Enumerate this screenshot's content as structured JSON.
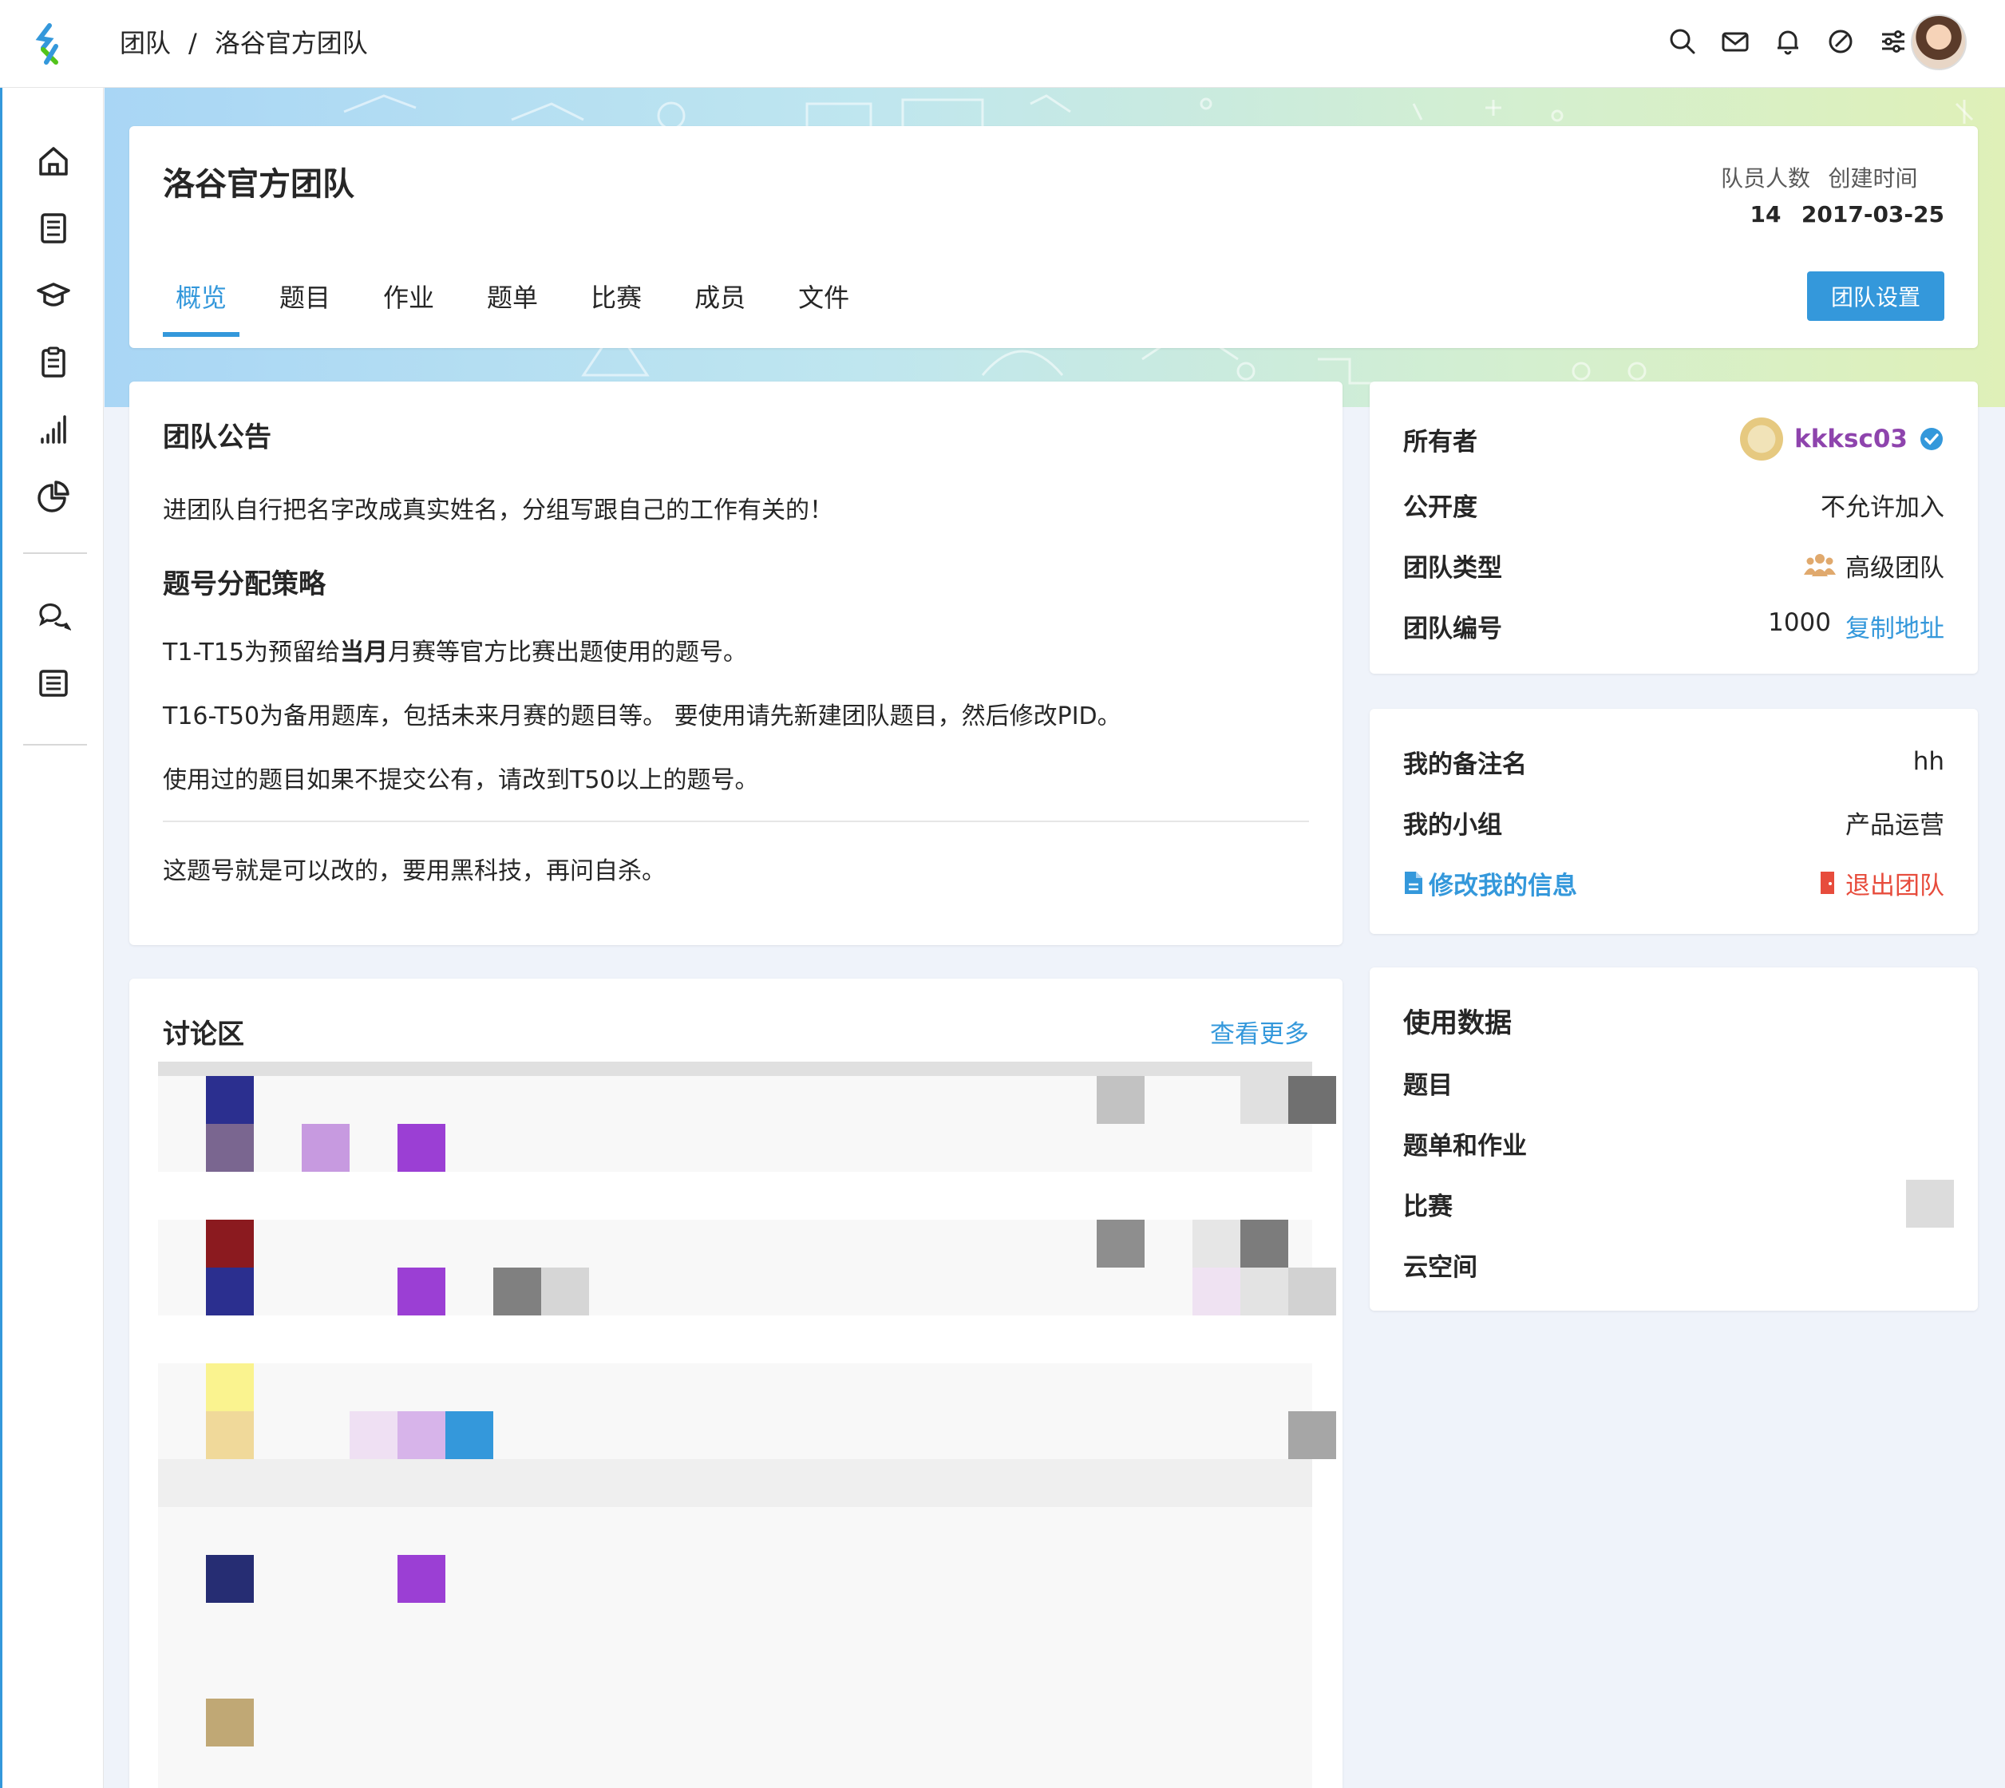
{
  "breadcrumb": {
    "root": "团队",
    "sep": "/",
    "current": "洛谷官方团队"
  },
  "topbar_icons": [
    "search-icon",
    "mail-icon",
    "bell-icon",
    "feedback-icon",
    "settings-sliders-icon"
  ],
  "nav_icons": [
    "home-icon",
    "book-icon",
    "graduation-cap-icon",
    "clipboard-icon",
    "signal-bars-icon",
    "pie-chart-icon",
    "chat-bubbles-icon",
    "news-icon"
  ],
  "team": {
    "name": "洛谷官方团队",
    "member_count_label": "队员人数",
    "member_count": "14",
    "created_label": "创建时间",
    "created": "2017-03-25",
    "tabs": [
      "概览",
      "题目",
      "作业",
      "题单",
      "比赛",
      "成员",
      "文件"
    ],
    "active_tab": "概览",
    "settings_button": "团队设置"
  },
  "announcement": {
    "title": "团队公告",
    "line1": "进团队自行把名字改成真实姓名，分组写跟自己的工作有关的！",
    "subtitle": "题号分配策略",
    "line2_pre": "T1-T15为预留给",
    "line2_bold": "当月",
    "line2_post": "月赛等官方比赛出题使用的题号。",
    "line3": "T16-T50为备用题库，包括未来月赛的题目等。 要使用请先新建团队题目，然后修改PID。",
    "line4": "使用过的题目如果不提交公有，请改到T50以上的题号。",
    "line5": "这题号就是可以改的，要用黑科技，再问自杀。"
  },
  "info": {
    "owner_label": "所有者",
    "owner_name": "kkksc03",
    "visibility_label": "公开度",
    "visibility": "不允许加入",
    "type_label": "团队类型",
    "type": "高级团队",
    "id_label": "团队编号",
    "id": "1000",
    "copy_link": "复制地址"
  },
  "mine": {
    "nickname_label": "我的备注名",
    "nickname": "hh",
    "group_label": "我的小组",
    "group": "产品运营",
    "edit_link": "修改我的信息",
    "leave_link": "退出团队"
  },
  "usage": {
    "title": "使用数据",
    "items": [
      "题目",
      "题单和作业",
      "比赛",
      "云空间"
    ]
  },
  "discussion": {
    "title": "讨论区",
    "more": "查看更多"
  },
  "colors": {
    "accent": "#3498db",
    "danger": "#e74c3c",
    "owner": "#8e44ad"
  }
}
